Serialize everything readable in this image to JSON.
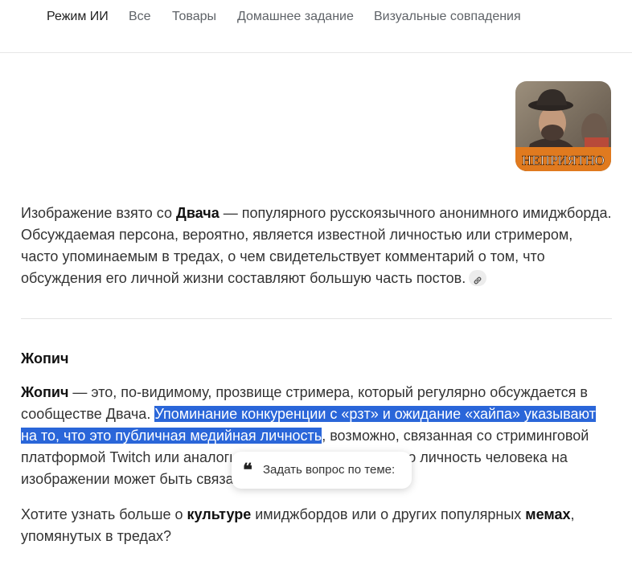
{
  "nav": {
    "tabs": [
      {
        "label": "Режим ИИ",
        "active": true
      },
      {
        "label": "Все",
        "active": false
      },
      {
        "label": "Товары",
        "active": false
      },
      {
        "label": "Домашнее задание",
        "active": false
      },
      {
        "label": "Визуальные совпадения",
        "active": false
      }
    ]
  },
  "thumbnail": {
    "caption": "НЕПРИЯТНО",
    "caption_color": "#ffffff",
    "caption_bg": "#e07a1f"
  },
  "intro": {
    "t1": "Изображение взято со ",
    "b1": "Двача",
    "t2": " — популярного русскоязычного анонимного имиджборда. Обсуждаемая персона, вероятно, является известной личностью или стримером, часто упоминаемым в тредах, о чем свидетельствует комментарий о том, что обсуждения его личной жизни составляют большую часть постов.",
    "link_icon": "link-icon"
  },
  "section": {
    "heading": "Жопич",
    "b1": "Жопич",
    "t1": " — это, по-видимому, прозвище стримера, который регулярно обсуждается в сообществе Двача. ",
    "selected": "Упоминание конкуренции с «рзт» и ожидание «хайпа» указывают на то, что это публичная медийная личность",
    "t2": ", возможно, связанная со стриминговой платформой Twitch или аналогичными сервисами. Однако личность человека на изображении может быть связана с разными людьми."
  },
  "followup": {
    "t1": "Хотите узнать больше о ",
    "b1": "культуре",
    "t2": " имиджбордов или о других популярных ",
    "b2": "мемах",
    "t3": ", упомянутых в тредах?"
  },
  "popover": {
    "icon": "quote-icon",
    "label": "Задать вопрос по теме:"
  },
  "colors": {
    "selection": "#2a66d9",
    "text": "#333333",
    "nav_inactive": "#5f6368"
  }
}
